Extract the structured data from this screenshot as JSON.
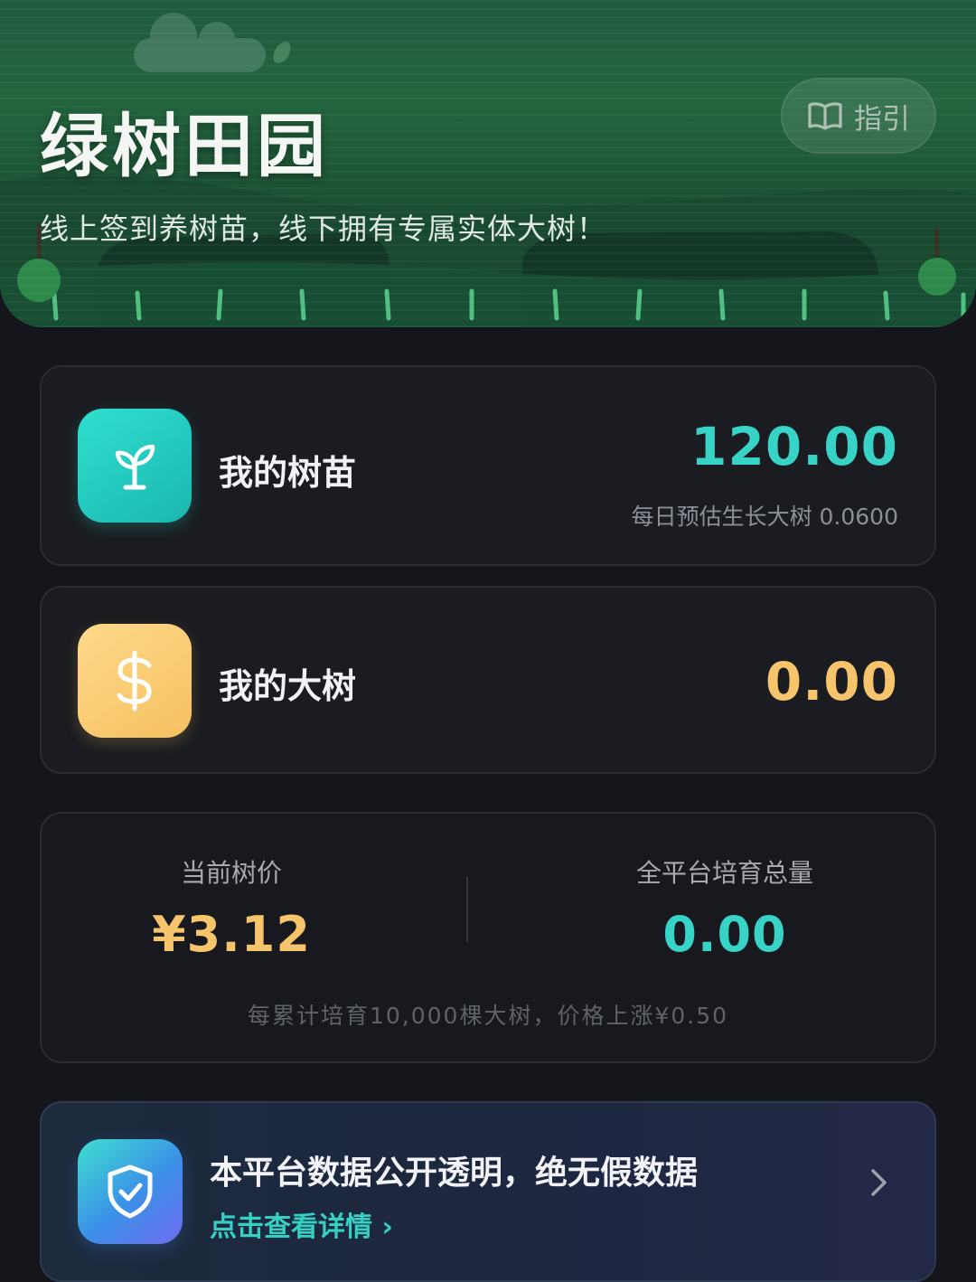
{
  "header": {
    "title": "绿树田园",
    "subtitle": "线上签到养树苗，线下拥有专属实体大树！",
    "guide_label": "指引"
  },
  "seedling": {
    "label": "我的树苗",
    "value": "120.00",
    "note": "每日预估生长大树 0.0600",
    "icon": "seedling-icon"
  },
  "tree": {
    "label": "我的大树",
    "value": "0.00",
    "icon": "dollar-icon"
  },
  "stats": {
    "price_label": "当前树价",
    "price_value": "¥3.12",
    "total_label": "全平台培育总量",
    "total_value": "0.00",
    "note": "每累计培育10,000棵大树，价格上涨¥0.50"
  },
  "trust": {
    "title": "本平台数据公开透明，绝无假数据",
    "link": "点击查看详情 ›",
    "icon": "shield-check-icon"
  },
  "colors": {
    "teal": "#36d3c6",
    "gold": "#f6c56b",
    "background": "#14161b",
    "banner": "#1f5a3f"
  }
}
